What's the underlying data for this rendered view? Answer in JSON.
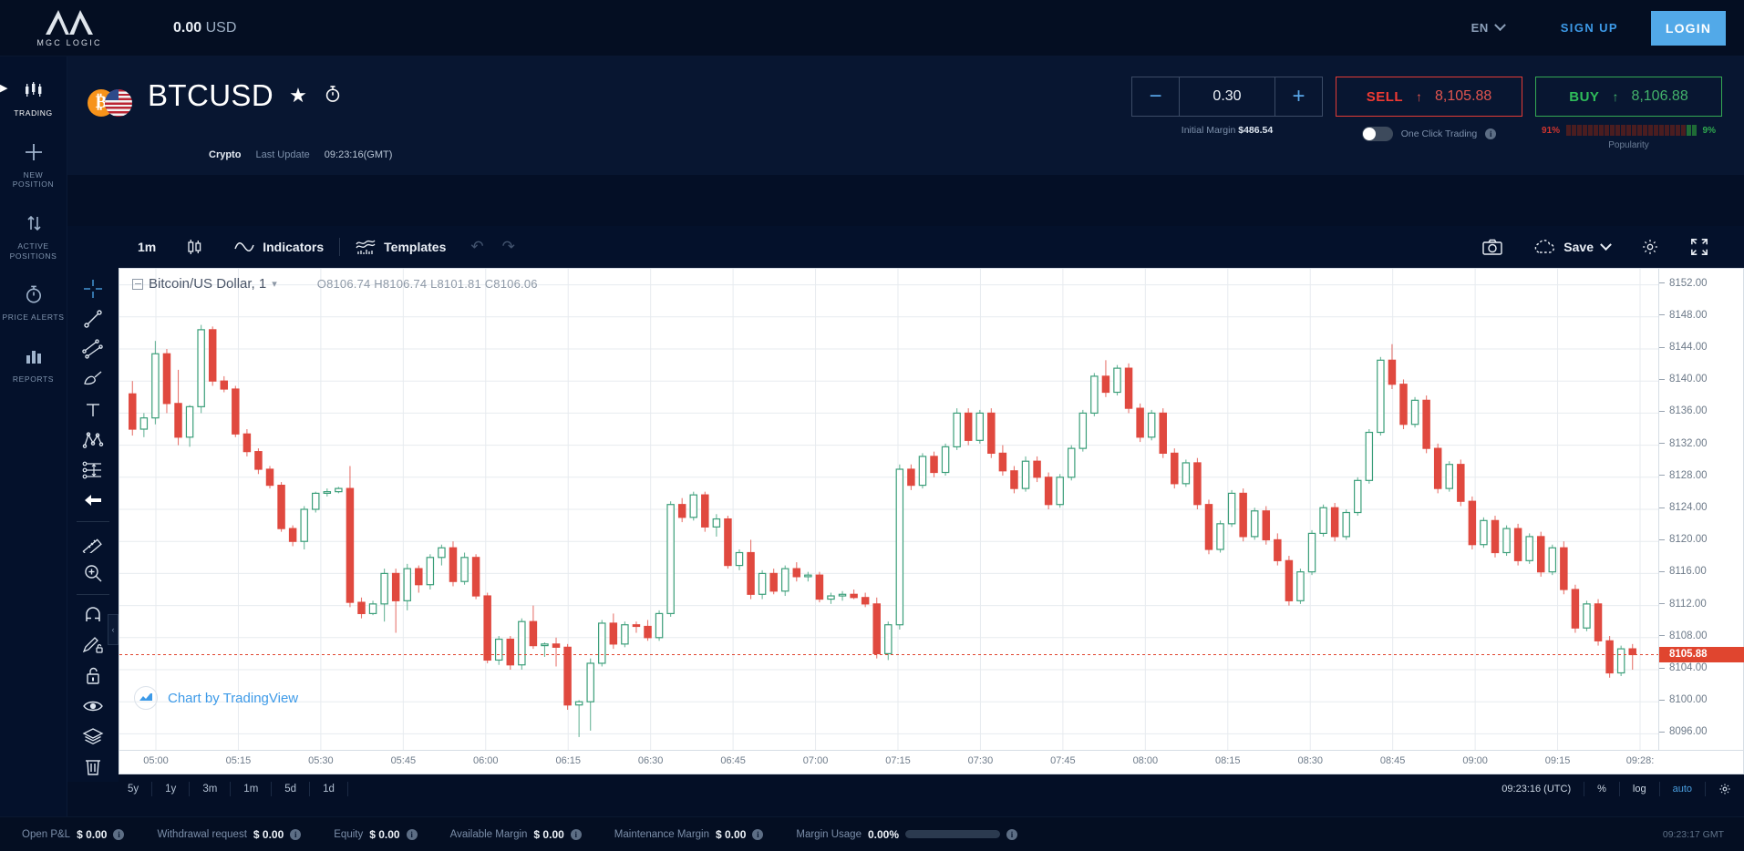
{
  "topbar": {
    "logo_name": "MGC LOGIC",
    "logo_icon": "mountain-m-logo",
    "balance_amount": "0.00",
    "balance_currency": "USD",
    "lang": "EN",
    "lang_chevron_icon": "chevron-down-icon",
    "signup_label": "SIGN UP",
    "login_label": "LOGIN",
    "login_bg": "#52a9e8"
  },
  "sidebar": {
    "collapse_icon": "chevron-right-icon",
    "items": [
      {
        "label": "TRADING",
        "icon": "candlestick-icon",
        "active": true
      },
      {
        "label": "NEW POSITION",
        "icon": "plus-icon",
        "active": false
      },
      {
        "label": "ACTIVE POSITIONS",
        "icon": "up-down-arrows-icon",
        "active": false
      },
      {
        "label": "PRICE ALERTS",
        "icon": "stopwatch-icon",
        "active": false
      },
      {
        "label": "REPORTS",
        "icon": "bar-chart-icon",
        "active": false
      }
    ]
  },
  "symbol": {
    "name": "BTCUSD",
    "base_icon": "bitcoin-icon",
    "quote_icon": "us-flag-icon",
    "favorite_icon": "star-icon",
    "alert_icon": "stopwatch-icon",
    "category": "Crypto",
    "last_update_label": "Last Update",
    "last_update_time": "09:23:16(GMT)"
  },
  "trade": {
    "qty_minus_icon": "minus-icon",
    "qty_plus_icon": "plus-icon",
    "quantity": "0.30",
    "initial_margin_label": "Initial Margin",
    "initial_margin_value": "$486.54",
    "sell_label": "SELL",
    "sell_price": "8,105.88",
    "sell_arrow_icon": "arrow-up-icon",
    "sell_color": "#f03a33",
    "buy_label": "BUY",
    "buy_price": "8,106.88",
    "buy_arrow_icon": "arrow-up-icon",
    "buy_color": "#2fbc5a",
    "one_click_label": "One Click Trading",
    "one_click_enabled": false,
    "one_click_info_icon": "info-icon",
    "popularity_label": "Popularity",
    "popularity_sell_pct": "91%",
    "popularity_buy_pct": "9%",
    "popularity_segments": 24,
    "popularity_green_segments": 2
  },
  "chart_toolbar": {
    "timeframe": "1m",
    "candle_icon": "candlestick-icon",
    "indicators_label": "Indicators",
    "indicators_icon": "wave-line-icon",
    "templates_label": "Templates",
    "templates_icon": "template-chart-icon",
    "undo_icon": "undo-arrow-icon",
    "redo_icon": "redo-arrow-icon",
    "snapshot_icon": "camera-icon",
    "save_label": "Save",
    "save_icon": "cloud-icon",
    "save_chevron_icon": "chevron-down-icon",
    "settings_icon": "gear-icon",
    "fullscreen_icon": "fullscreen-icon"
  },
  "draw_tools": [
    {
      "icon": "crosshair-icon",
      "active": true
    },
    {
      "icon": "trend-line-icon",
      "active": false
    },
    {
      "icon": "parallel-channel-icon",
      "active": false
    },
    {
      "icon": "brush-icon",
      "active": false
    },
    {
      "icon": "text-tool-icon",
      "active": false
    },
    {
      "icon": "pattern-icon",
      "active": false
    },
    {
      "icon": "position-tool-icon",
      "active": false
    },
    {
      "icon": "arrow-marker-icon",
      "active": false
    },
    {
      "icon": "ruler-icon",
      "active": false
    },
    {
      "icon": "zoom-in-icon",
      "active": false
    },
    {
      "icon": "magnet-icon",
      "active": false
    },
    {
      "icon": "pencil-lock-icon",
      "active": false
    },
    {
      "icon": "lock-icon",
      "active": false
    },
    {
      "icon": "eye-icon",
      "active": false
    },
    {
      "icon": "layers-icon",
      "active": false
    },
    {
      "icon": "trash-icon",
      "active": false
    }
  ],
  "chart_data": {
    "type": "line",
    "subtype": "candlestick",
    "title": "Bitcoin/US Dollar, 1",
    "collapse_icon": "minus-box-icon",
    "legend_chevron_icon": "chevron-down-icon",
    "ohlc": {
      "O": "8106.74",
      "H": "8106.74",
      "L": "8101.81",
      "C": "8106.06"
    },
    "ohlc_text": "O8106.74  H8106.74  L8101.81  C8106.06",
    "watermark": "Chart by TradingView",
    "watermark_icon": "tradingview-logo-icon",
    "xlabel": "",
    "ylabel": "",
    "ylim": [
      8094,
      8154
    ],
    "y_ticks": [
      "8152.00",
      "8148.00",
      "8144.00",
      "8140.00",
      "8136.00",
      "8132.00",
      "8128.00",
      "8124.00",
      "8120.00",
      "8116.00",
      "8112.00",
      "8108.00",
      "8104.00",
      "8100.00",
      "8096.00"
    ],
    "x_ticks": [
      "05:00",
      "05:15",
      "05:30",
      "05:45",
      "06:00",
      "06:15",
      "06:30",
      "06:45",
      "07:00",
      "07:15",
      "07:30",
      "07:45",
      "08:00",
      "08:15",
      "08:30",
      "08:45",
      "09:00",
      "09:15",
      "09:28:"
    ],
    "current_price": "8105.88",
    "current_price_color": "#e0452f",
    "up_color": "#3a9e79",
    "down_color": "#e0493f",
    "grid": true,
    "candles": [
      [
        8138.4,
        8140.0,
        8133.2,
        8134.0
      ],
      [
        8134.0,
        8136.0,
        8133.0,
        8135.4
      ],
      [
        8135.4,
        8145.0,
        8134.6,
        8143.4
      ],
      [
        8143.4,
        8144.0,
        8136.0,
        8137.2
      ],
      [
        8137.2,
        8141.4,
        8132.0,
        8133.0
      ],
      [
        8133.0,
        8137.0,
        8131.8,
        8136.8
      ],
      [
        8136.8,
        8147.0,
        8136.0,
        8146.4
      ],
      [
        8146.4,
        8146.8,
        8139.4,
        8140.0
      ],
      [
        8140.0,
        8140.6,
        8138.6,
        8139.0
      ],
      [
        8139.0,
        8139.4,
        8133.0,
        8133.4
      ],
      [
        8133.4,
        8134.0,
        8130.6,
        8131.2
      ],
      [
        8131.2,
        8131.6,
        8128.4,
        8129.0
      ],
      [
        8129.0,
        8129.4,
        8126.6,
        8127.0
      ],
      [
        8127.0,
        8127.4,
        8121.2,
        8121.6
      ],
      [
        8121.6,
        8122.0,
        8119.4,
        8120.0
      ],
      [
        8120.0,
        8124.4,
        8119.0,
        8124.0
      ],
      [
        8124.0,
        8126.2,
        8123.6,
        8126.0
      ],
      [
        8126.0,
        8126.6,
        8125.6,
        8126.2
      ],
      [
        8126.2,
        8126.8,
        8126.0,
        8126.6
      ],
      [
        8126.6,
        8129.4,
        8111.8,
        8112.4
      ],
      [
        8112.4,
        8113.0,
        8110.4,
        8111.0
      ],
      [
        8111.0,
        8112.6,
        8110.8,
        8112.2
      ],
      [
        8112.2,
        8116.6,
        8110.0,
        8116.0
      ],
      [
        8116.0,
        8116.6,
        8108.6,
        8112.6
      ],
      [
        8112.6,
        8117.2,
        8111.4,
        8116.6
      ],
      [
        8116.6,
        8117.0,
        8113.6,
        8114.6
      ],
      [
        8114.6,
        8118.4,
        8114.0,
        8118.0
      ],
      [
        8118.0,
        8119.6,
        8117.0,
        8119.2
      ],
      [
        8119.2,
        8120.0,
        8114.4,
        8115.0
      ],
      [
        8115.0,
        8118.6,
        8114.6,
        8118.0
      ],
      [
        8118.0,
        8118.4,
        8112.8,
        8113.2
      ],
      [
        8113.2,
        8113.6,
        8104.8,
        8105.2
      ],
      [
        8105.2,
        8108.2,
        8104.6,
        8107.8
      ],
      [
        8107.8,
        8108.2,
        8104.0,
        8104.6
      ],
      [
        8104.6,
        8110.4,
        8104.0,
        8110.0
      ],
      [
        8110.0,
        8112.0,
        8106.6,
        8107.0
      ],
      [
        8107.0,
        8107.4,
        8105.6,
        8107.2
      ],
      [
        8107.2,
        8108.0,
        8104.4,
        8106.8
      ],
      [
        8106.8,
        8107.2,
        8099.0,
        8099.6
      ],
      [
        8099.6,
        8100.2,
        8095.6,
        8100.0
      ],
      [
        8100.0,
        8105.4,
        8096.4,
        8104.8
      ],
      [
        8104.8,
        8110.2,
        8104.4,
        8109.8
      ],
      [
        8109.8,
        8111.0,
        8106.6,
        8107.2
      ],
      [
        8107.2,
        8110.0,
        8106.8,
        8109.6
      ],
      [
        8109.6,
        8110.0,
        8108.6,
        8109.4
      ],
      [
        8109.4,
        8110.2,
        8107.6,
        8108.0
      ],
      [
        8108.0,
        8111.4,
        8107.6,
        8111.0
      ],
      [
        8111.0,
        8125.0,
        8110.6,
        8124.6
      ],
      [
        8124.6,
        8125.4,
        8122.4,
        8123.0
      ],
      [
        8123.0,
        8126.2,
        8122.6,
        8125.8
      ],
      [
        8125.8,
        8126.2,
        8121.2,
        8121.8
      ],
      [
        8121.8,
        8123.4,
        8120.6,
        8122.8
      ],
      [
        8122.8,
        8123.2,
        8116.6,
        8117.0
      ],
      [
        8117.0,
        8119.0,
        8116.4,
        8118.6
      ],
      [
        8118.6,
        8120.2,
        8112.8,
        8113.4
      ],
      [
        8113.4,
        8116.4,
        8112.8,
        8116.0
      ],
      [
        8116.0,
        8116.6,
        8113.4,
        8113.8
      ],
      [
        8113.8,
        8117.0,
        8113.2,
        8116.6
      ],
      [
        8116.6,
        8117.4,
        8115.0,
        8115.6
      ],
      [
        8115.6,
        8116.2,
        8115.0,
        8115.8
      ],
      [
        8115.8,
        8116.2,
        8112.4,
        8112.8
      ],
      [
        8112.8,
        8113.6,
        8112.2,
        8113.2
      ],
      [
        8113.2,
        8113.8,
        8112.6,
        8113.4
      ],
      [
        8113.4,
        8114.0,
        8112.8,
        8113.0
      ],
      [
        8113.0,
        8113.6,
        8111.8,
        8112.2
      ],
      [
        8112.2,
        8113.0,
        8105.4,
        8106.0
      ],
      [
        8106.0,
        8110.0,
        8105.2,
        8109.6
      ],
      [
        8109.6,
        8129.6,
        8109.0,
        8129.0
      ],
      [
        8129.0,
        8129.6,
        8126.4,
        8127.0
      ],
      [
        8127.0,
        8131.0,
        8126.6,
        8130.6
      ],
      [
        8130.6,
        8131.2,
        8128.0,
        8128.6
      ],
      [
        8128.6,
        8132.2,
        8128.2,
        8131.8
      ],
      [
        8131.8,
        8136.6,
        8131.4,
        8136.0
      ],
      [
        8136.0,
        8136.6,
        8132.0,
        8132.6
      ],
      [
        8132.6,
        8136.4,
        8132.2,
        8136.0
      ],
      [
        8136.0,
        8136.6,
        8130.4,
        8131.0
      ],
      [
        8131.0,
        8132.0,
        8128.2,
        8128.8
      ],
      [
        8128.8,
        8129.4,
        8126.0,
        8126.6
      ],
      [
        8126.6,
        8130.6,
        8126.2,
        8130.0
      ],
      [
        8130.0,
        8130.6,
        8127.4,
        8128.0
      ],
      [
        8128.0,
        8128.6,
        8124.0,
        8124.6
      ],
      [
        8124.6,
        8128.4,
        8124.2,
        8128.0
      ],
      [
        8128.0,
        8132.0,
        8127.6,
        8131.6
      ],
      [
        8131.6,
        8136.4,
        8131.2,
        8136.0
      ],
      [
        8136.0,
        8141.0,
        8135.6,
        8140.6
      ],
      [
        8140.6,
        8142.6,
        8138.0,
        8138.6
      ],
      [
        8138.6,
        8142.0,
        8138.2,
        8141.6
      ],
      [
        8141.6,
        8142.2,
        8136.0,
        8136.6
      ],
      [
        8136.6,
        8137.2,
        8132.4,
        8133.0
      ],
      [
        8133.0,
        8136.4,
        8132.6,
        8136.0
      ],
      [
        8136.0,
        8136.6,
        8130.4,
        8131.0
      ],
      [
        8131.0,
        8131.6,
        8126.6,
        8127.2
      ],
      [
        8127.2,
        8130.2,
        8126.8,
        8129.8
      ],
      [
        8129.8,
        8130.4,
        8124.0,
        8124.6
      ],
      [
        8124.6,
        8125.2,
        8118.4,
        8119.0
      ],
      [
        8119.0,
        8122.6,
        8118.6,
        8122.2
      ],
      [
        8122.2,
        8126.4,
        8121.8,
        8126.0
      ],
      [
        8126.0,
        8126.6,
        8120.0,
        8120.6
      ],
      [
        8120.6,
        8124.2,
        8120.2,
        8123.8
      ],
      [
        8123.8,
        8124.4,
        8119.6,
        8120.2
      ],
      [
        8120.2,
        8121.0,
        8117.0,
        8117.6
      ],
      [
        8117.6,
        8118.2,
        8112.0,
        8112.6
      ],
      [
        8112.6,
        8116.6,
        8112.2,
        8116.2
      ],
      [
        8116.2,
        8121.4,
        8115.8,
        8121.0
      ],
      [
        8121.0,
        8124.6,
        8120.6,
        8124.2
      ],
      [
        8124.2,
        8124.8,
        8120.0,
        8120.6
      ],
      [
        8120.6,
        8124.0,
        8120.2,
        8123.6
      ],
      [
        8123.6,
        8128.0,
        8123.2,
        8127.6
      ],
      [
        8127.6,
        8134.0,
        8127.2,
        8133.6
      ],
      [
        8133.6,
        8143.0,
        8133.2,
        8142.6
      ],
      [
        8142.6,
        8144.6,
        8139.0,
        8139.6
      ],
      [
        8139.6,
        8140.2,
        8134.0,
        8134.6
      ],
      [
        8134.6,
        8138.0,
        8134.2,
        8137.6
      ],
      [
        8137.6,
        8138.2,
        8131.0,
        8131.6
      ],
      [
        8131.6,
        8132.2,
        8126.0,
        8126.6
      ],
      [
        8126.6,
        8130.0,
        8126.2,
        8129.6
      ],
      [
        8129.6,
        8130.2,
        8124.4,
        8125.0
      ],
      [
        8125.0,
        8125.6,
        8119.0,
        8119.6
      ],
      [
        8119.6,
        8123.0,
        8119.2,
        8122.6
      ],
      [
        8122.6,
        8123.2,
        8118.0,
        8118.6
      ],
      [
        8118.6,
        8122.0,
        8118.2,
        8121.6
      ],
      [
        8121.6,
        8122.2,
        8117.0,
        8117.6
      ],
      [
        8117.6,
        8121.0,
        8117.2,
        8120.6
      ],
      [
        8120.6,
        8121.2,
        8115.6,
        8116.2
      ],
      [
        8116.2,
        8119.6,
        8115.8,
        8119.2
      ],
      [
        8119.2,
        8120.0,
        8113.4,
        8114.0
      ],
      [
        8114.0,
        8114.6,
        8108.6,
        8109.2
      ],
      [
        8109.2,
        8112.6,
        8108.8,
        8112.2
      ],
      [
        8112.2,
        8112.8,
        8107.0,
        8107.6
      ],
      [
        8107.6,
        8108.2,
        8103.0,
        8103.6
      ],
      [
        8103.6,
        8107.0,
        8103.2,
        8106.6
      ],
      [
        8106.6,
        8107.2,
        8104.0,
        8105.88
      ]
    ]
  },
  "chart_bottom": {
    "ranges": [
      "5y",
      "1y",
      "3m",
      "1m",
      "5d",
      "1d"
    ],
    "clock": "09:23:16 (UTC)",
    "percent_label": "%",
    "log_label": "log",
    "auto_label": "auto",
    "settings_icon": "gear-icon"
  },
  "status_bar": {
    "items": [
      {
        "label": "Open P&L",
        "value": "$ 0.00",
        "info_icon": "info-icon"
      },
      {
        "label": "Withdrawal request",
        "value": "$ 0.00",
        "info_icon": "info-icon"
      },
      {
        "label": "Equity",
        "value": "$ 0.00",
        "info_icon": "info-icon"
      },
      {
        "label": "Available Margin",
        "value": "$ 0.00",
        "info_icon": "info-icon"
      },
      {
        "label": "Maintenance Margin",
        "value": "$ 0.00",
        "info_icon": "info-icon"
      }
    ],
    "margin_usage_label": "Margin Usage",
    "margin_usage_value": "0.00%",
    "margin_usage_info_icon": "info-icon",
    "clock": "09:23:17 GMT"
  }
}
